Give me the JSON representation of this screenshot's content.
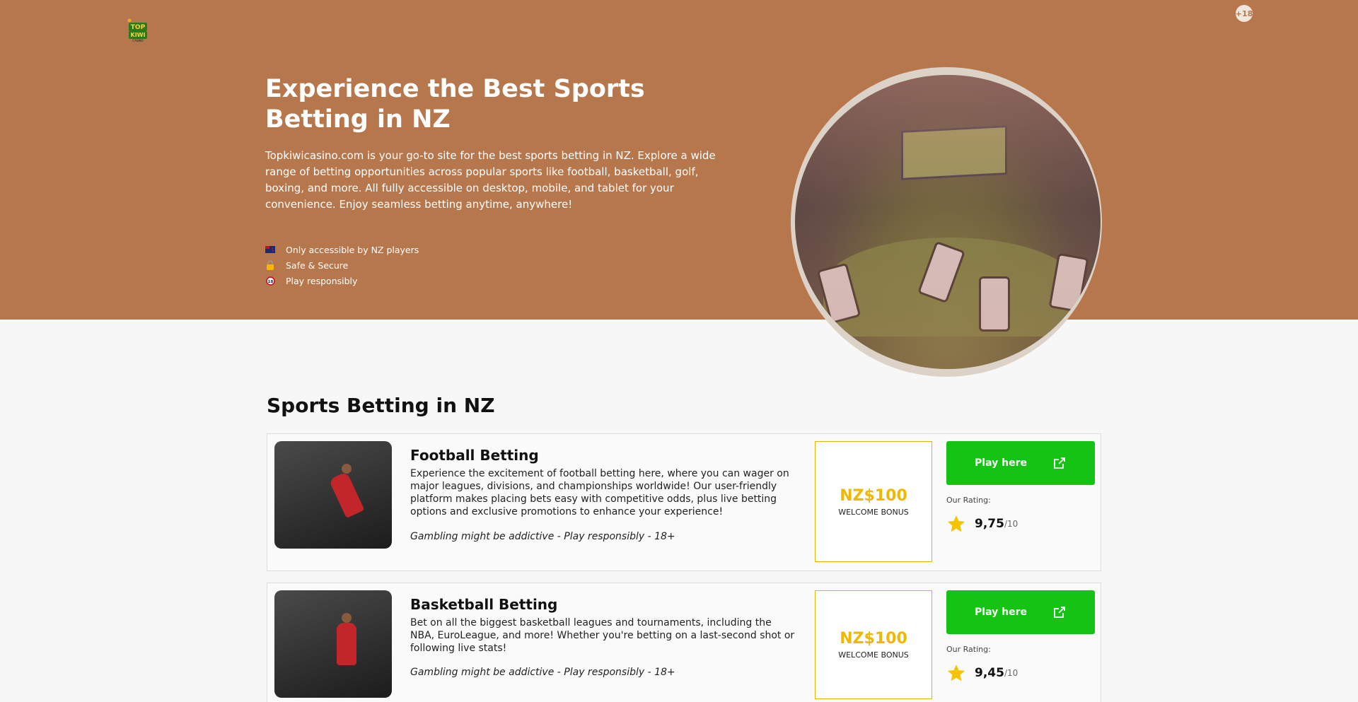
{
  "header": {
    "logo_text": "TOP KIWI CASINO",
    "age_badge": "+18"
  },
  "hero": {
    "title": "Experience the Best Sports Betting in NZ",
    "description": "Topkiwicasino.com is your go-to site for the best sports betting in NZ. Explore a wide range of betting opportunities across popular sports like football, basketball, golf, boxing, and more. All fully accessible on desktop, mobile, and tablet for your convenience. Enjoy seamless betting anytime, anywhere!",
    "features": [
      {
        "icon": "nz-flag-icon",
        "text": "Only accessible by NZ players"
      },
      {
        "icon": "lock-icon",
        "text": "Safe & Secure"
      },
      {
        "icon": "eighteen-plus-icon",
        "text": "Play responsibly"
      }
    ]
  },
  "section": {
    "title": "Sports Betting in NZ"
  },
  "cards": [
    {
      "title": "Football Betting",
      "description": "Experience the excitement of football betting here, where you can wager on major leagues, divisions, and championships worldwide! Our user-friendly platform makes placing bets easy with competitive odds, plus live betting options and exclusive promotions to enhance your experience!",
      "note": "Gambling might be addictive - Play responsibly - 18+",
      "bonus_amount": "NZ$100",
      "bonus_label": "WELCOME BONUS",
      "button_label": "Play here",
      "rating_label": "Our Rating:",
      "rating_value": "9,75",
      "rating_max": "/10"
    },
    {
      "title": "Basketball Betting",
      "description": "Bet on all the biggest basketball leagues and tournaments, including the NBA, EuroLeague, and more! Whether you're betting on a last-second shot or following live stats!",
      "note": "Gambling might be addictive - Play responsibly - 18+",
      "bonus_amount": "NZ$100",
      "bonus_label": "WELCOME BONUS",
      "button_label": "Play here",
      "rating_label": "Our Rating:",
      "rating_value": "9,45",
      "rating_max": "/10"
    }
  ],
  "colors": {
    "hero_bg": "#b7774c",
    "button": "#14c314",
    "bonus": "#f0b800",
    "star": "#f5c400"
  }
}
